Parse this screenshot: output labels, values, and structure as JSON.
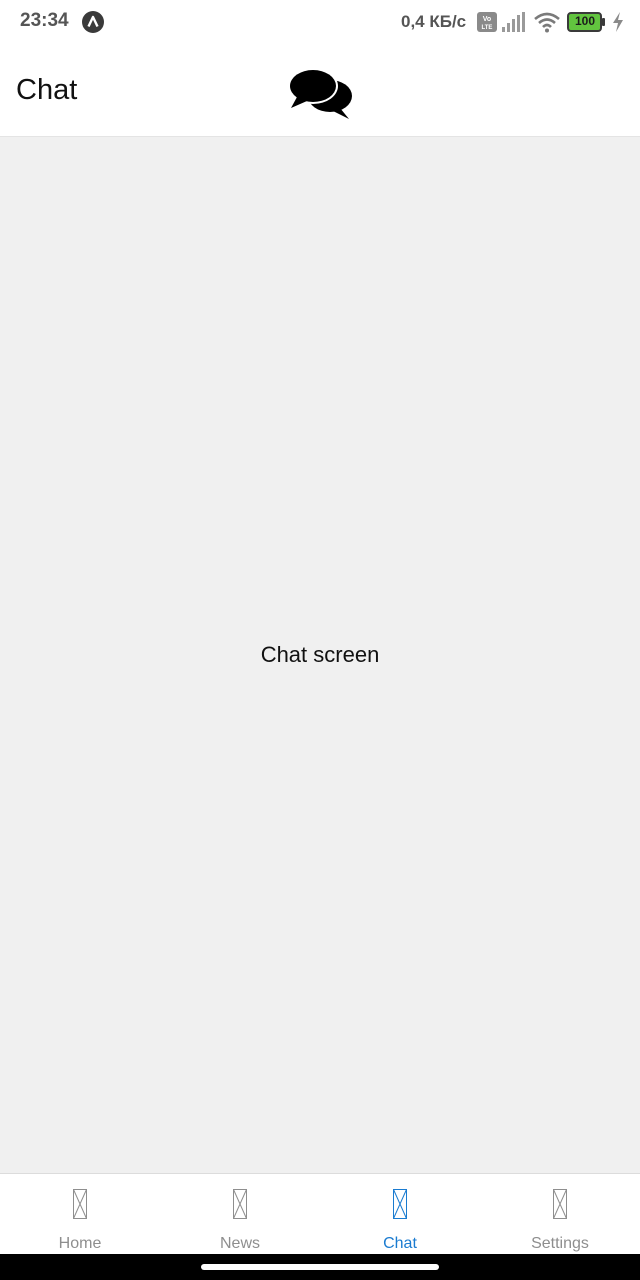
{
  "status_bar": {
    "time": "23:34",
    "network_speed": "0,4 КБ/с",
    "battery_level": "100",
    "icons": [
      "app-notification-icon",
      "volte-icon",
      "signal-icon",
      "wifi-icon",
      "battery-icon",
      "charging-bolt-icon"
    ]
  },
  "header": {
    "title": "Chat",
    "icon": "chat-bubbles-icon"
  },
  "content": {
    "text": "Chat screen",
    "background_color": "#f0f0f0"
  },
  "tabs": [
    {
      "label": "Home",
      "icon": "missing-glyph-icon",
      "active": false
    },
    {
      "label": "News",
      "icon": "missing-glyph-icon",
      "active": false
    },
    {
      "label": "Chat",
      "icon": "missing-glyph-icon",
      "active": true
    },
    {
      "label": "Settings",
      "icon": "missing-glyph-icon",
      "active": false
    }
  ],
  "colors": {
    "accent": "#1a7bd0",
    "inactive_tab": "#8e8e8e",
    "battery_fill": "#62c43f"
  }
}
